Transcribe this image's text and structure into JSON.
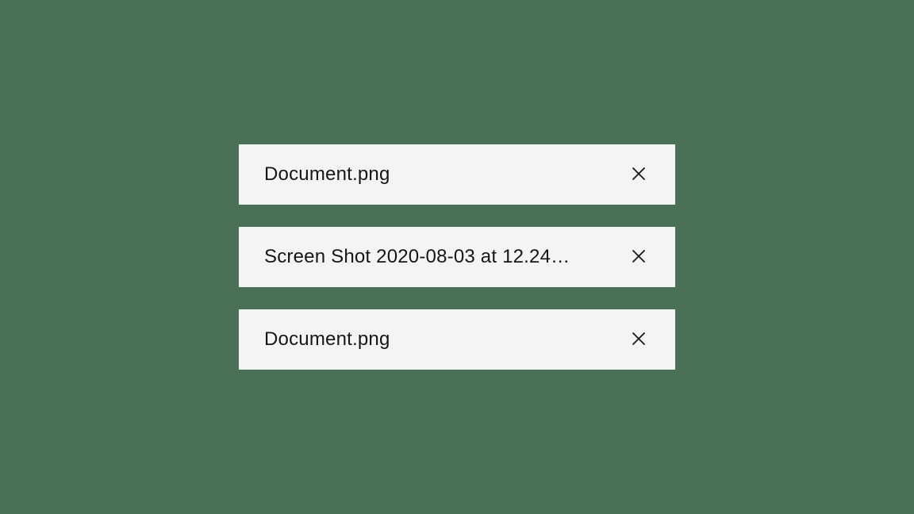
{
  "files": [
    {
      "name": "Document.png"
    },
    {
      "name": "Screen Shot 2020-08-03 at 12.24…"
    },
    {
      "name": "Document.png"
    }
  ]
}
